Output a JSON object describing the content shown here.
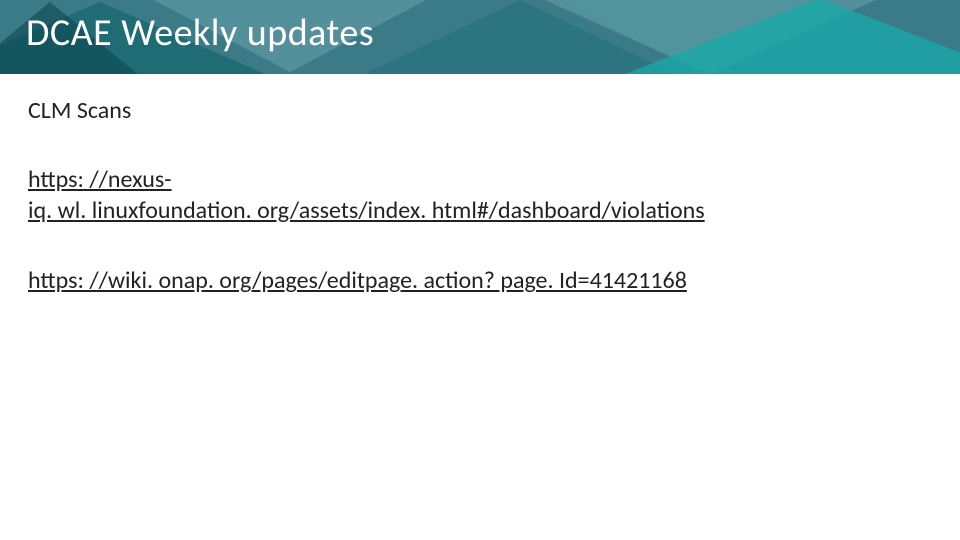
{
  "banner": {
    "title": "DCAE Weekly updates"
  },
  "body": {
    "subheading": "CLM Scans",
    "link1_line1": "https: //nexus-",
    "link1_line2": "iq. wl. linuxfoundation. org/assets/index. html#/dashboard/violations",
    "link2": "https: //wiki. onap. org/pages/editpage. action? page. Id=41421168"
  }
}
